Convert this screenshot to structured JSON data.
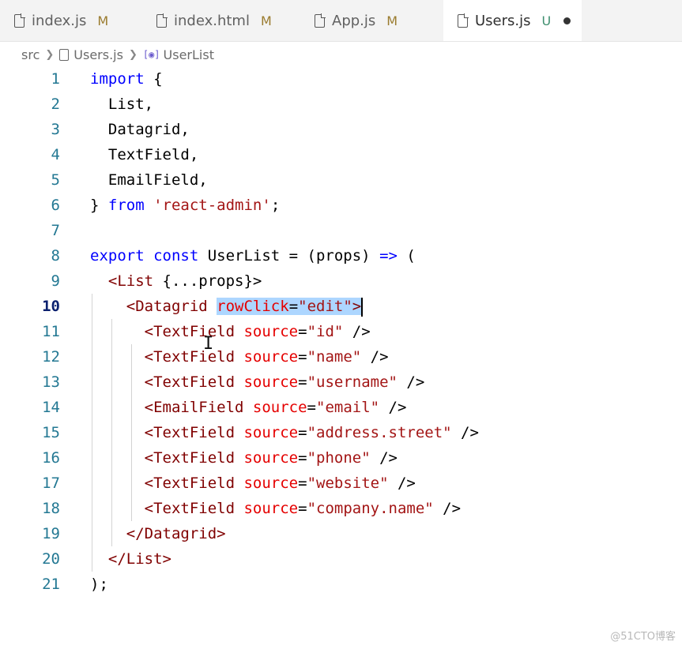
{
  "tabs": [
    {
      "label": "index.js",
      "status": "M"
    },
    {
      "label": "index.html",
      "status": "M"
    },
    {
      "label": "App.js",
      "status": "M"
    },
    {
      "label": "Users.js",
      "status": "U"
    }
  ],
  "breadcrumb": {
    "folder": "src",
    "file": "Users.js",
    "symbol": "UserList"
  },
  "line_numbers": [
    "1",
    "2",
    "3",
    "4",
    "5",
    "6",
    "7",
    "8",
    "9",
    "10",
    "11",
    "12",
    "13",
    "14",
    "15",
    "16",
    "17",
    "18",
    "19",
    "20",
    "21"
  ],
  "code": {
    "l1_kw": "import",
    "l1_rest": " {",
    "l2": "  List,",
    "l3": "  Datagrid,",
    "l4": "  TextField,",
    "l5": "  EmailField,",
    "l6_a": "} ",
    "l6_kw": "from",
    "l6_str": " 'react-admin'",
    "l6_end": ";",
    "l8_kw1": "export",
    "l8_kw2": " const",
    "l8_rest": " UserList = (props) ",
    "l8_arrow": "=>",
    "l8_end": " (",
    "l9_tag": "  <List",
    "l9_rest": " {...props}>",
    "l10_tag": "    <Datagrid",
    "l10_sel_attr": "rowClick",
    "l10_sel_eq": "=",
    "l10_sel_str": "\"edit\"",
    "l10_sel_close": ">",
    "fields": [
      {
        "tag": "      <TextField",
        "attr": " source",
        "value": "\"id\"",
        "end": " />"
      },
      {
        "tag": "      <TextField",
        "attr": " source",
        "value": "\"name\"",
        "end": " />"
      },
      {
        "tag": "      <TextField",
        "attr": " source",
        "value": "\"username\"",
        "end": " />"
      },
      {
        "tag": "      <EmailField",
        "attr": " source",
        "value": "\"email\"",
        "end": " />"
      },
      {
        "tag": "      <TextField",
        "attr": " source",
        "value": "\"address.street\"",
        "end": " />"
      },
      {
        "tag": "      <TextField",
        "attr": " source",
        "value": "\"phone\"",
        "end": " />"
      },
      {
        "tag": "      <TextField",
        "attr": " source",
        "value": "\"website\"",
        "end": " />"
      },
      {
        "tag": "      <TextField",
        "attr": " source",
        "value": "\"company.name\"",
        "end": " />"
      }
    ],
    "l19": "    </Datagrid>",
    "l20": "  </List>",
    "l21": ");"
  },
  "watermark": "@51CTO博客",
  "colors": {
    "keyword": "#0000ff",
    "tag": "#800000",
    "attribute": "#e50000",
    "string": "#a31515",
    "selection": "#add6ff",
    "line_number": "#237893"
  }
}
